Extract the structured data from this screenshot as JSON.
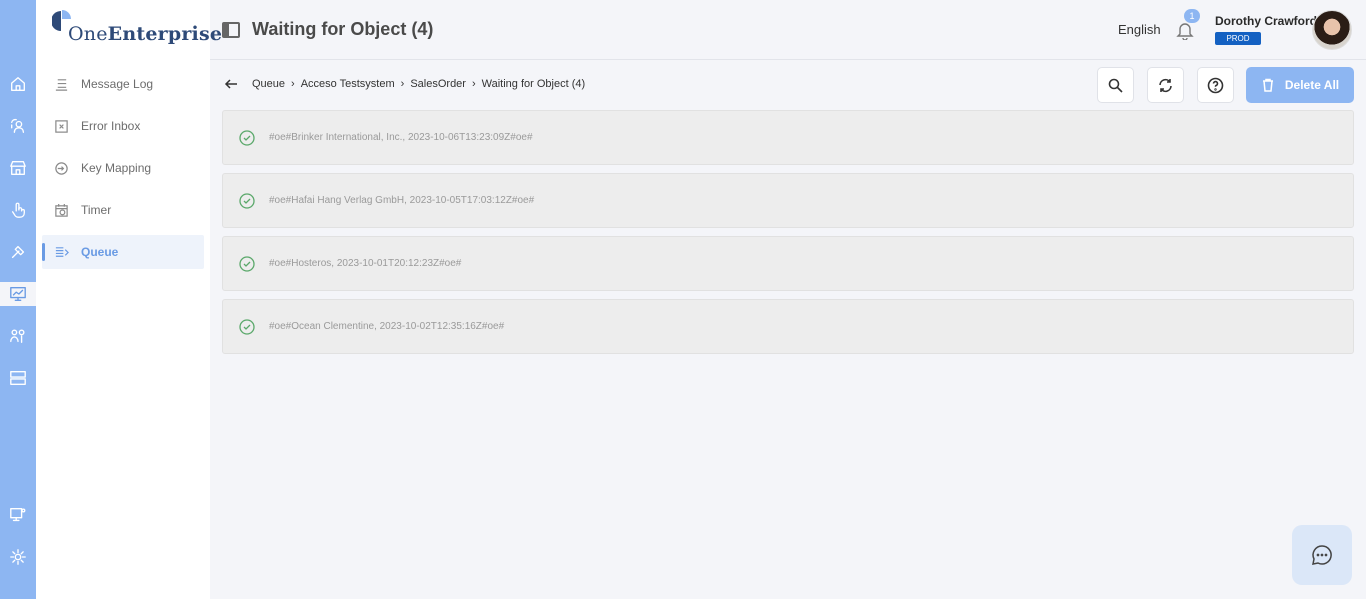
{
  "app": {
    "logo_text_light": "One",
    "logo_text_bold": "Enterprise",
    "accent_color": "#8db6f2",
    "badge_color": "#1461c2"
  },
  "rail": {
    "icons": [
      "home-icon",
      "user-sync-icon",
      "store-icon",
      "touch-icon",
      "tools-icon",
      "monitor-chart-icon",
      "people-icon",
      "server-icon",
      "desktop-settings-icon",
      "gear-icon"
    ],
    "active": "monitor-chart-icon"
  },
  "sidebar": {
    "items": [
      {
        "label": "Message Log",
        "icon": "list-icon"
      },
      {
        "label": "Error Inbox",
        "icon": "inbox-error-icon"
      },
      {
        "label": "Key Mapping",
        "icon": "key-icon"
      },
      {
        "label": "Timer",
        "icon": "calendar-clock-icon"
      },
      {
        "label": "Queue",
        "icon": "queue-icon",
        "active": true
      }
    ]
  },
  "header": {
    "title": "Waiting for Object (4)",
    "language": "English",
    "notification_count": "1",
    "user_name": "Dorothy Crawford",
    "environment": "PROD"
  },
  "breadcrumb": [
    "Queue",
    "Acceso Testsystem",
    "SalesOrder",
    "Waiting for Object (4)"
  ],
  "toolbar": {
    "delete_all_label": "Delete All"
  },
  "items": [
    "#oe#Brinker International, Inc., 2023-10-06T13:23:09Z#oe#",
    "#oe#Hafai Hang Verlag GmbH, 2023-10-05T17:03:12Z#oe#",
    "#oe#Hosteros, 2023-10-01T20:12:23Z#oe#",
    "#oe#Ocean Clementine, 2023-10-02T12:35:16Z#oe#"
  ]
}
